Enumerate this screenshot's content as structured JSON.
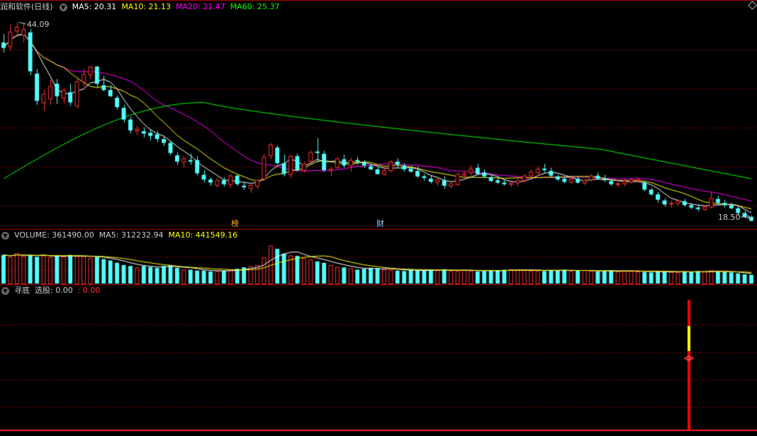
{
  "panels": {
    "price": {
      "title": "润和软件(日线)",
      "ma5": "MA5: 20.31",
      "ma10": "MA10: 21.13",
      "ma20": "MA20: 21.47",
      "ma60": "MA60: 25.37",
      "high_label": "44.09",
      "low_label": "18.50",
      "marker_bang": "榜",
      "marker_cai": "财"
    },
    "volume": {
      "title": "VOLUME: 361490.00",
      "ma5": "MA5: 312232.94",
      "ma10": "MA10: 441549.16"
    },
    "indicator": {
      "title": "寻底",
      "xuangu": "选股: 0.00",
      "value2": ": 0.00"
    }
  },
  "colors": {
    "up": "#ff3232",
    "down": "#54ffff",
    "ma5": "#ffffff",
    "ma10": "#ffff00",
    "ma20": "#ff00ff",
    "ma60": "#00ff00",
    "grid": "#8b0000",
    "border": "#b00000"
  },
  "chart_data": {
    "type": "candlestick",
    "ylim": [
      18.0,
      45.5
    ],
    "high": 44.09,
    "low": 18.5,
    "ohlc": [
      [
        41.5,
        42.6,
        40.2,
        40.8
      ],
      [
        41.0,
        43.8,
        40.5,
        42.9
      ],
      [
        43.0,
        44.09,
        42.2,
        43.5
      ],
      [
        42.5,
        44.0,
        41.5,
        43.2
      ],
      [
        42.8,
        43.2,
        37.3,
        37.8
      ],
      [
        37.5,
        38.1,
        33.5,
        34.0
      ],
      [
        33.8,
        35.4,
        32.7,
        34.9
      ],
      [
        34.3,
        36.7,
        33.5,
        35.9
      ],
      [
        36.2,
        36.8,
        33.6,
        34.6
      ],
      [
        34.4,
        35.6,
        33.6,
        35.4
      ],
      [
        35.1,
        36.2,
        33.4,
        33.8
      ],
      [
        33.4,
        37.1,
        33.0,
        36.5
      ],
      [
        36.5,
        38.1,
        35.8,
        37.4
      ],
      [
        37.4,
        38.5,
        36.8,
        38.4
      ],
      [
        38.4,
        38.5,
        35.8,
        36.2
      ],
      [
        36.0,
        37.2,
        35.2,
        35.4
      ],
      [
        35.4,
        36.0,
        34.5,
        34.6
      ],
      [
        34.4,
        34.7,
        32.9,
        33.2
      ],
      [
        33.1,
        33.5,
        31.2,
        31.6
      ],
      [
        31.6,
        32.0,
        29.8,
        30.2
      ],
      [
        30.2,
        30.8,
        29.6,
        30.4
      ],
      [
        30.1,
        30.6,
        29.3,
        29.8
      ],
      [
        29.9,
        30.4,
        28.9,
        29.5
      ],
      [
        29.7,
        30.1,
        28.7,
        29.1
      ],
      [
        29.1,
        29.4,
        28.2,
        28.6
      ],
      [
        28.6,
        28.9,
        27.0,
        27.3
      ],
      [
        27.0,
        27.4,
        25.8,
        26.2
      ],
      [
        26.2,
        26.9,
        25.4,
        26.6
      ],
      [
        26.4,
        27.2,
        25.8,
        26.2
      ],
      [
        26.4,
        26.9,
        24.4,
        24.7
      ],
      [
        24.5,
        25.1,
        23.5,
        23.9
      ],
      [
        23.9,
        24.2,
        23.1,
        23.5
      ],
      [
        23.2,
        24.1,
        22.9,
        23.8
      ],
      [
        23.8,
        24.2,
        23.0,
        23.3
      ],
      [
        23.3,
        24.6,
        22.8,
        24.4
      ],
      [
        24.4,
        24.5,
        23.1,
        23.3
      ],
      [
        23.1,
        23.6,
        22.6,
        22.9
      ],
      [
        22.8,
        23.4,
        22.2,
        23.2
      ],
      [
        23.1,
        24.0,
        22.7,
        23.8
      ],
      [
        24.0,
        27.2,
        23.7,
        26.8
      ],
      [
        27.0,
        28.6,
        26.5,
        28.4
      ],
      [
        28.0,
        28.3,
        25.8,
        26.0
      ],
      [
        26.0,
        27.1,
        24.3,
        24.6
      ],
      [
        24.6,
        27.1,
        24.1,
        26.9
      ],
      [
        26.9,
        27.2,
        24.9,
        25.1
      ],
      [
        25.1,
        26.2,
        24.8,
        25.9
      ],
      [
        26.3,
        27.7,
        25.9,
        27.4
      ],
      [
        27.5,
        29.2,
        26.1,
        27.3
      ],
      [
        27.2,
        27.6,
        24.9,
        25.1
      ],
      [
        25.1,
        25.5,
        24.3,
        25.3
      ],
      [
        25.5,
        26.8,
        25.2,
        26.6
      ],
      [
        26.5,
        27.1,
        25.4,
        25.7
      ],
      [
        25.7,
        26.7,
        24.9,
        26.4
      ],
      [
        26.4,
        26.8,
        25.8,
        26.2
      ],
      [
        26.1,
        26.4,
        25.4,
        25.7
      ],
      [
        25.6,
        25.9,
        25.1,
        25.2
      ],
      [
        25.2,
        25.6,
        24.5,
        24.6
      ],
      [
        24.6,
        25.4,
        24.4,
        25.1
      ],
      [
        25.1,
        26.4,
        24.8,
        26.2
      ],
      [
        26.2,
        26.6,
        25.4,
        25.8
      ],
      [
        25.7,
        26.0,
        24.9,
        25.2
      ],
      [
        25.3,
        25.7,
        24.8,
        24.9
      ],
      [
        25.0,
        25.6,
        24.1,
        24.3
      ],
      [
        24.3,
        24.6,
        23.8,
        24.1
      ],
      [
        24.0,
        24.4,
        23.4,
        23.6
      ],
      [
        23.6,
        24.1,
        23.1,
        23.9
      ],
      [
        23.8,
        24.3,
        22.7,
        23.1
      ],
      [
        23.1,
        23.7,
        22.8,
        23.4
      ],
      [
        23.3,
        24.8,
        23.1,
        24.6
      ],
      [
        24.5,
        25.0,
        24.1,
        24.7
      ],
      [
        24.8,
        25.7,
        24.4,
        25.3
      ],
      [
        25.4,
        25.9,
        24.5,
        24.6
      ],
      [
        24.8,
        25.2,
        24.1,
        24.3
      ],
      [
        24.2,
        24.6,
        23.6,
        23.7
      ],
      [
        23.8,
        24.1,
        23.3,
        23.5
      ],
      [
        23.5,
        23.9,
        23.1,
        23.3
      ],
      [
        23.3,
        23.6,
        22.9,
        23.5
      ],
      [
        23.5,
        24.1,
        23.0,
        23.8
      ],
      [
        23.8,
        24.6,
        23.6,
        24.4
      ],
      [
        24.4,
        25.2,
        23.9,
        24.9
      ],
      [
        24.8,
        25.6,
        24.4,
        25.3
      ],
      [
        25.3,
        25.9,
        24.8,
        25.1
      ],
      [
        25.0,
        25.4,
        24.2,
        24.4
      ],
      [
        24.3,
        24.5,
        23.7,
        23.9
      ],
      [
        24.0,
        24.3,
        23.4,
        23.6
      ],
      [
        23.6,
        24.2,
        23.4,
        24.0
      ],
      [
        24.0,
        24.3,
        23.4,
        23.5
      ],
      [
        23.5,
        24.0,
        23.2,
        23.8
      ],
      [
        23.9,
        24.6,
        23.6,
        24.4
      ],
      [
        24.4,
        24.8,
        23.9,
        24.0
      ],
      [
        24.0,
        24.5,
        23.6,
        23.8
      ],
      [
        23.7,
        24.0,
        23.1,
        23.3
      ],
      [
        23.3,
        23.6,
        22.9,
        23.4
      ],
      [
        23.4,
        23.9,
        23.0,
        23.7
      ],
      [
        23.6,
        24.0,
        23.4,
        23.9
      ],
      [
        23.8,
        24.1,
        23.6,
        23.9
      ],
      [
        23.5,
        23.7,
        22.4,
        22.6
      ],
      [
        22.6,
        22.8,
        21.8,
        22.0
      ],
      [
        22.0,
        22.3,
        20.9,
        21.3
      ],
      [
        21.2,
        21.5,
        20.4,
        20.7
      ],
      [
        20.8,
        21.2,
        20.3,
        20.9
      ],
      [
        20.9,
        21.4,
        20.5,
        21.2
      ],
      [
        21.1,
        21.4,
        20.4,
        20.6
      ],
      [
        20.6,
        20.9,
        20.1,
        20.3
      ],
      [
        20.3,
        20.7,
        19.8,
        20.1
      ],
      [
        20.1,
        20.6,
        19.9,
        20.4
      ],
      [
        20.4,
        22.3,
        20.2,
        21.5
      ],
      [
        21.4,
        21.8,
        20.7,
        20.9
      ],
      [
        20.9,
        21.3,
        20.3,
        20.6
      ],
      [
        20.6,
        20.9,
        20.1,
        20.2
      ],
      [
        20.2,
        20.5,
        19.3,
        19.6
      ],
      [
        19.6,
        19.9,
        18.9,
        19.1
      ],
      [
        19.1,
        19.3,
        18.5,
        18.6
      ]
    ],
    "volume": [
      62,
      58,
      66,
      60,
      61,
      58,
      63,
      57,
      60,
      58,
      62,
      60,
      59,
      55,
      58,
      53,
      50,
      45,
      40,
      38,
      35,
      38,
      36,
      34,
      38,
      40,
      34,
      30,
      30,
      28,
      28,
      26,
      27,
      28,
      30,
      32,
      35,
      38,
      40,
      56,
      82,
      75,
      65,
      61,
      60,
      55,
      52,
      48,
      45,
      40,
      36,
      35,
      33,
      30,
      32,
      34,
      33,
      31,
      30,
      28,
      27,
      30,
      28,
      28,
      30,
      29,
      31,
      28,
      27,
      30,
      28,
      26,
      27,
      29,
      28,
      30,
      31,
      30,
      29,
      28,
      28,
      27,
      29,
      28,
      30,
      27,
      28,
      29,
      27,
      26,
      27,
      28,
      26,
      28,
      27,
      26,
      25,
      24,
      27,
      26,
      25,
      24,
      26,
      25,
      27,
      26,
      28,
      26,
      25,
      24,
      22,
      20,
      19
    ],
    "volume_ylim": [
      0,
      92
    ],
    "signal": {
      "index": 120,
      "value": 1
    }
  }
}
